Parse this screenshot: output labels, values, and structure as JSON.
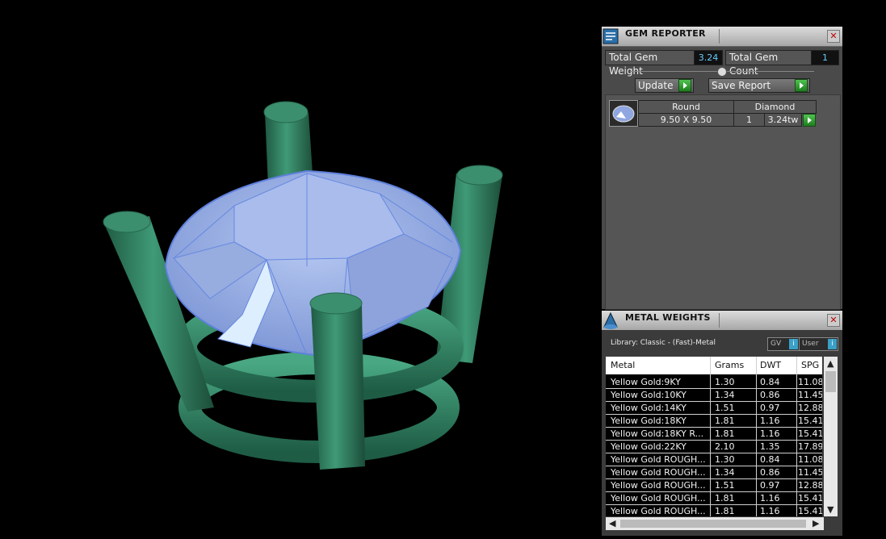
{
  "gem_reporter": {
    "title": "GEM REPORTER",
    "total_weight_label": "Total Gem Weight",
    "total_weight_value": "3.24",
    "total_count_label": "Total Gem Count",
    "total_count_value": "1",
    "update_label": "Update",
    "save_report_label": "Save Report",
    "gem": {
      "shape": "Round",
      "material": "Diamond",
      "size": "9.50 X 9.50",
      "count": "1",
      "weight": "3.24tw"
    }
  },
  "metal_weights": {
    "title": "METAL WEIGHTS",
    "library": "Library: Classic - (Fast)-Metal",
    "toggle_gv": "GV",
    "toggle_user": "User",
    "columns": [
      "Metal",
      "Grams",
      "DWT",
      "SPG"
    ],
    "rows": [
      [
        "Yellow Gold:9KY",
        "1.30",
        "0.84",
        "11.08"
      ],
      [
        "Yellow Gold:10KY",
        "1.34",
        "0.86",
        "11.45"
      ],
      [
        "Yellow Gold:14KY",
        "1.51",
        "0.97",
        "12.88"
      ],
      [
        "Yellow Gold:18KY",
        "1.81",
        "1.16",
        "15.41"
      ],
      [
        "Yellow Gold:18KY R...",
        "1.81",
        "1.16",
        "15.41"
      ],
      [
        "Yellow Gold:22KY",
        "2.10",
        "1.35",
        "17.89"
      ],
      [
        "Yellow Gold ROUGH...",
        "1.30",
        "0.84",
        "11.08"
      ],
      [
        "Yellow Gold ROUGH...",
        "1.34",
        "0.86",
        "11.45"
      ],
      [
        "Yellow Gold ROUGH...",
        "1.51",
        "0.97",
        "12.88"
      ],
      [
        "Yellow Gold ROUGH...",
        "1.81",
        "1.16",
        "15.41"
      ],
      [
        "Yellow Gold ROUGH...",
        "1.81",
        "1.16",
        "15.41"
      ]
    ]
  }
}
